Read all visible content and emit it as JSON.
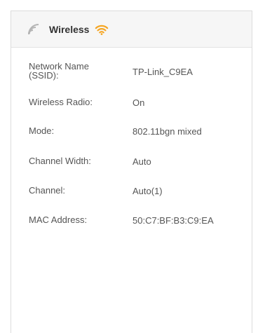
{
  "panel": {
    "title": "Wireless",
    "header_icons": {
      "left": "signal-bars-icon",
      "right": "wifi-icon"
    },
    "accent_color": "#f5a623",
    "rows": [
      {
        "label": "Network Name (SSID):",
        "value": "TP-Link_C9EA"
      },
      {
        "label": "Wireless Radio:",
        "value": "On"
      },
      {
        "label": "Mode:",
        "value": "802.11bgn mixed"
      },
      {
        "label": "Channel Width:",
        "value": "Auto"
      },
      {
        "label": "Channel:",
        "value": "Auto(1)"
      },
      {
        "label": "MAC Address:",
        "value": "50:C7:BF:B3:C9:EA"
      }
    ]
  }
}
